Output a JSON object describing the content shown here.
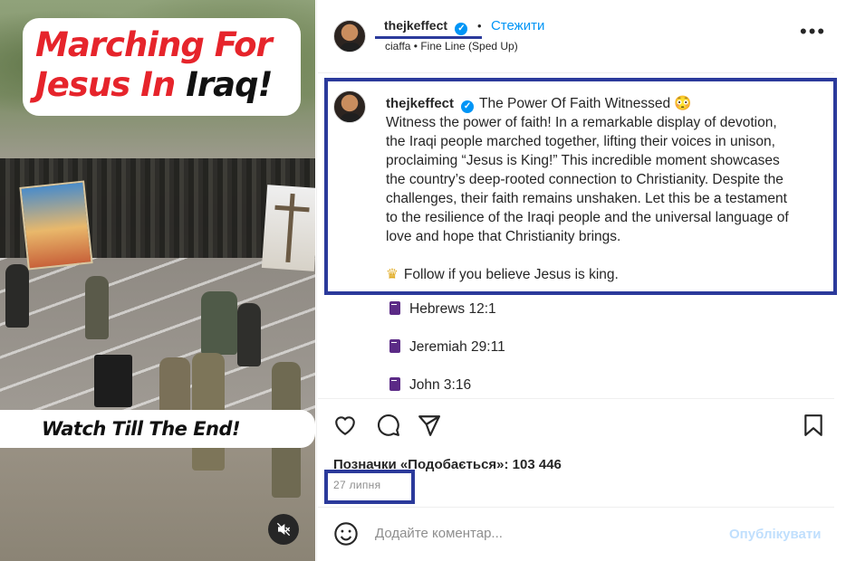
{
  "video": {
    "title_part1": "Marching For",
    "title_part2": "Jesus In ",
    "title_part3": "Iraq!",
    "bottom_text": "Watch Till The End!",
    "mute_icon": "speaker-muted-icon"
  },
  "header": {
    "username": "thejkeffect",
    "follow_label": "Стежити",
    "music": "ciaffa • Fine Line (Sped Up)",
    "more_icon": "more-options-icon"
  },
  "caption": {
    "username": "thejkeffect",
    "lines": [
      "The Power Of Faith Witnessed 😳",
      "Witness the power of faith! In a remarkable display of devotion,",
      "the Iraqi people marched together, lifting their voices in unison,",
      "proclaiming “Jesus is King!” This incredible moment showcases",
      "the country’s deep-rooted connection to Christianity. Despite the",
      "challenges, their faith remains unshaken. Let this be a testament",
      "to the resilience of the Iraqi people and the universal language of",
      "love and hope that Christianity brings."
    ],
    "follow_line": "Follow if you believe Jesus is king.",
    "references": [
      "Hebrews 12:1",
      "Jeremiah 29:11",
      "John 3:16"
    ]
  },
  "actions": {
    "like_icon": "heart-icon",
    "comment_icon": "comment-icon",
    "share_icon": "share-icon",
    "save_icon": "bookmark-icon"
  },
  "likes": "Позначки «Подобається»: 103 446",
  "date": "27 липня",
  "comment": {
    "placeholder": "Додайте коментар...",
    "post_label": "Опублікувати"
  },
  "colors": {
    "accent": "#0095f6",
    "highlight_box": "#2b3a9b",
    "title_red": "#e6242b"
  }
}
